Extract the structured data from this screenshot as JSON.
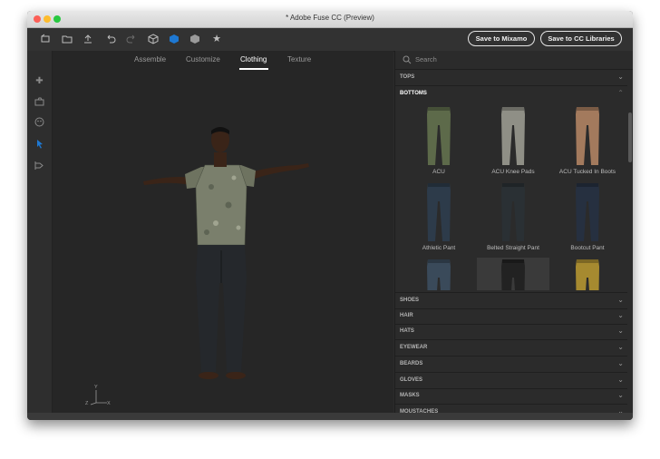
{
  "window": {
    "title": "* Adobe Fuse CC (Preview)"
  },
  "toolbar": {
    "save_mixamo": "Save to Mixamo",
    "save_cc": "Save to CC Libraries",
    "icons": [
      "cube-add-icon",
      "folder-open-icon",
      "upload-icon",
      "undo-icon",
      "redo-icon",
      "box-icon",
      "cube-blue-icon",
      "cube-dark-icon",
      "star-icon"
    ]
  },
  "left_tools": [
    "move-icon",
    "camera-icon",
    "face-icon",
    "pointer-icon",
    "render-icon"
  ],
  "tabs": [
    {
      "label": "Assemble"
    },
    {
      "label": "Customize"
    },
    {
      "label": "Clothing",
      "active": true
    },
    {
      "label": "Texture"
    }
  ],
  "axis": {
    "y": "Y",
    "z": "Z",
    "x": "X"
  },
  "panel": {
    "search_placeholder": "Search",
    "categories_top": [
      {
        "label": "TOPS"
      }
    ],
    "open_category": "BOTTOMS",
    "items": [
      {
        "label": "ACU",
        "color": "#5d6a4a"
      },
      {
        "label": "ACU Knee Pads",
        "color": "#8f8f86"
      },
      {
        "label": "ACU Tucked In Boots",
        "color": "#a37a5d"
      },
      {
        "label": "Athletic Pant",
        "color": "#2d3b4a"
      },
      {
        "label": "Belted Straight Pant",
        "color": "#2a3034"
      },
      {
        "label": "Bootcut Pant",
        "color": "#263040"
      },
      {
        "label": "",
        "color": "#3a4a5a"
      },
      {
        "label": "",
        "color": "#222222"
      },
      {
        "label": "",
        "color": "#a68a30"
      }
    ],
    "categories_bottom": [
      {
        "label": "SHOES"
      },
      {
        "label": "HAIR"
      },
      {
        "label": "HATS"
      },
      {
        "label": "EYEWEAR"
      },
      {
        "label": "BEARDS"
      },
      {
        "label": "GLOVES"
      },
      {
        "label": "MASKS"
      },
      {
        "label": "MOUSTACHES"
      }
    ]
  },
  "colors": {
    "accent": "#1e78d2",
    "background": "#2b2b2b"
  }
}
